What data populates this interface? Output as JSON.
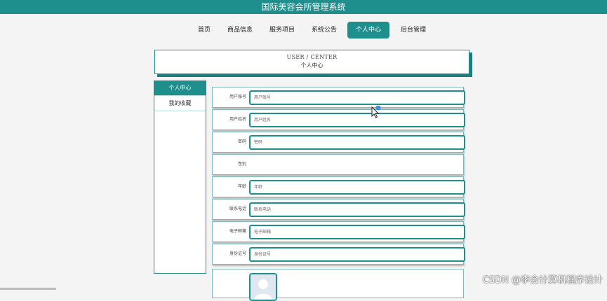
{
  "app_title": "国际美容会所管理系统",
  "nav": [
    "首页",
    "商品信息",
    "服务项目",
    "系统公告",
    "个人中心",
    "后台管理"
  ],
  "page_title": {
    "en": "USER / CENTER",
    "cn": "个人中心"
  },
  "sidebar": [
    "个人中心",
    "我的收藏"
  ],
  "form": {
    "fields": [
      {
        "label": "用户账号",
        "placeholder": "用户账号"
      },
      {
        "label": "用户姓名",
        "placeholder": "用户姓名"
      },
      {
        "label": "密码",
        "placeholder": "密码"
      },
      {
        "label": "性别",
        "placeholder": ""
      },
      {
        "label": "年龄",
        "placeholder": "年龄"
      },
      {
        "label": "联系电话",
        "placeholder": "联系电话"
      },
      {
        "label": "电子邮箱",
        "placeholder": "电子邮箱"
      },
      {
        "label": "身份证号",
        "placeholder": "身份证号"
      }
    ]
  },
  "watermark": "CSDN @李会计算机程序设计",
  "colors": {
    "accent": "#1f8f8d"
  },
  "icons": {
    "avatar": "user-avatar-icon",
    "cursor": "mouse-cursor-icon"
  }
}
